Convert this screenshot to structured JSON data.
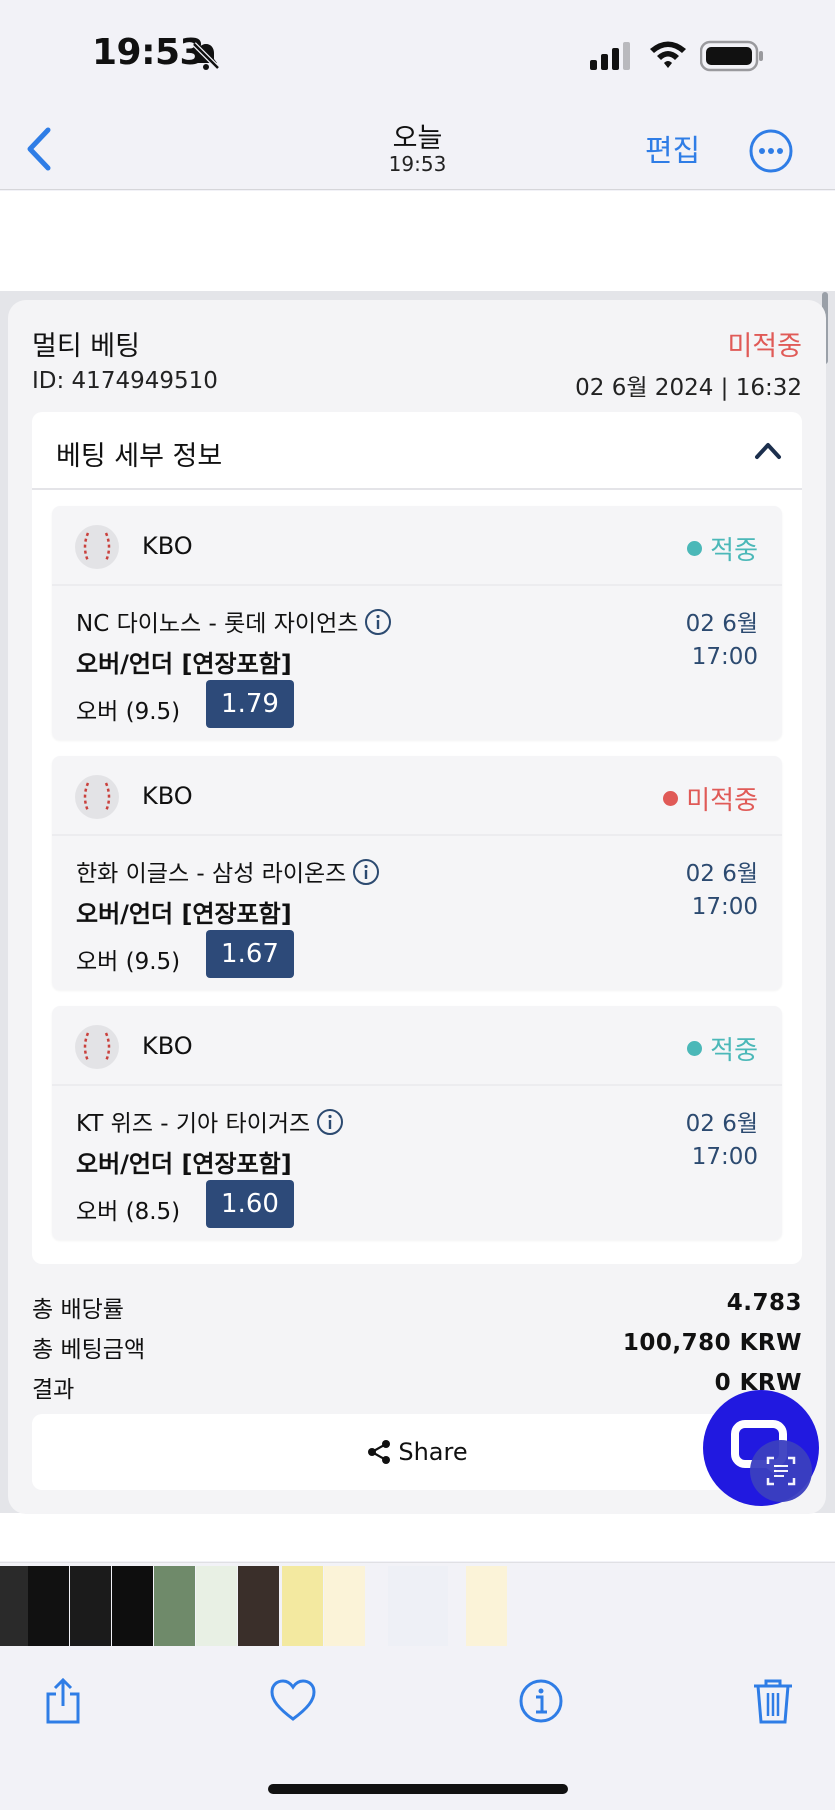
{
  "status_bar": {
    "time": "19:53"
  },
  "nav": {
    "title": "오늘",
    "subtitle": "19:53",
    "edit_label": "편집"
  },
  "bet": {
    "type_title": "멀티 베팅",
    "status": "미적중",
    "id_text": "ID: 4174949510",
    "date_text": "02 6월 2024 | 16:32",
    "details_title": "베팅 세부 정보",
    "legs": [
      {
        "league": "KBO",
        "result": "적중",
        "match": "NC 다이노스 - 롯데 자이언츠",
        "date": "02 6월",
        "time": "17:00",
        "market": "오버/언더 [연장포함]",
        "pick": "오버 (9.5)",
        "odds": "1.79"
      },
      {
        "league": "KBO",
        "result": "미적중",
        "match": "한화 이글스 - 삼성 라이온즈",
        "date": "02 6월",
        "time": "17:00",
        "market": "오버/언더 [연장포함]",
        "pick": "오버 (9.5)",
        "odds": "1.67"
      },
      {
        "league": "KBO",
        "result": "적중",
        "match": "KT 위즈 - 기아 타이거즈",
        "date": "02 6월",
        "time": "17:00",
        "market": "오버/언더 [연장포함]",
        "pick": "오버 (8.5)",
        "odds": "1.60"
      }
    ],
    "summary": {
      "total_odds_label": "총 배당률",
      "total_odds": "4.783",
      "total_stake_label": "총 베팅금액",
      "total_stake": "100,780 KRW",
      "result_label": "결과",
      "result": "0 KRW"
    },
    "share_label": "Share"
  },
  "colors": {
    "accent_blue": "#2f7de6",
    "win": "#4bb8b8",
    "lose": "#e05a57",
    "odds_bg": "#2d4a79",
    "fab": "#2119e0"
  },
  "icons": [
    "bell-slash-icon",
    "signal-icon",
    "wifi-icon",
    "battery-icon",
    "back-chevron-icon",
    "more-icon",
    "baseball-icon",
    "info-icon",
    "chevron-up-icon",
    "share-icon",
    "chat-icon",
    "scan-text-icon",
    "share-upload-icon",
    "heart-icon",
    "info-circle-icon",
    "trash-icon"
  ]
}
